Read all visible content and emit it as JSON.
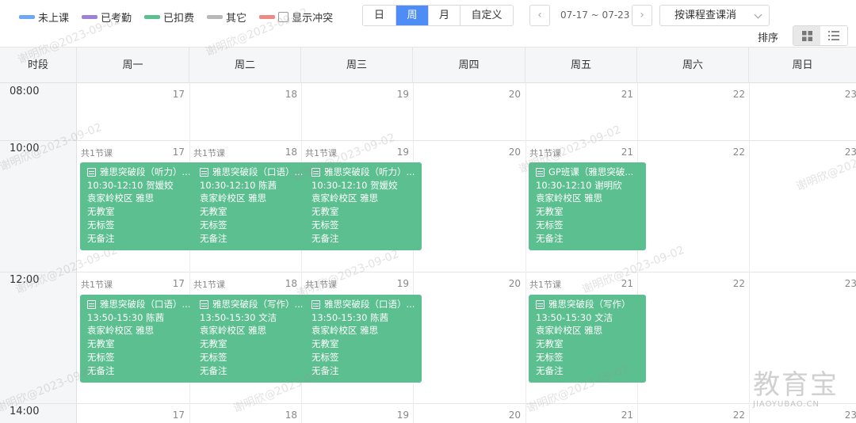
{
  "legend": [
    {
      "label": "未上课",
      "color": "#6ea7f2"
    },
    {
      "label": "已考勤",
      "color": "#9c82d6"
    },
    {
      "label": "已扣费",
      "color": "#5bbf8f"
    },
    {
      "label": "其它",
      "color": "#b8b8b8"
    },
    {
      "label": "显示冲突",
      "color": "#ee8a85"
    }
  ],
  "view_tabs": [
    "日",
    "周",
    "月",
    "自定义"
  ],
  "active_view": "周",
  "date_range": "07-17 ~ 07-23",
  "nav": {
    "prev": "‹",
    "next": "›"
  },
  "filter_select": "按课程查课消",
  "sort_label": "排序",
  "calendar": {
    "time_header": "时段",
    "days": [
      "周一",
      "周二",
      "周三",
      "周四",
      "周五",
      "周六",
      "周日"
    ],
    "dates": [
      "17",
      "18",
      "19",
      "20",
      "21",
      "22",
      "23"
    ],
    "slots": [
      "08:00",
      "10:00",
      "12:00",
      "14:00"
    ],
    "count_label": "共1节课"
  },
  "events": {
    "slot1": [
      {
        "day": 0,
        "title": "雅思突破段（听力）...",
        "time_teacher": "10:30-12:10  贺媛姣",
        "campus": "袁家岭校区    雅思",
        "room": "无教室",
        "tag": "无标签",
        "note": "无备注"
      },
      {
        "day": 1,
        "title": "雅思突破段（口语）...",
        "time_teacher": "10:30-12:10  陈茜",
        "campus": "袁家岭校区    雅思",
        "room": "无教室",
        "tag": "无标签",
        "note": "无备注"
      },
      {
        "day": 2,
        "title": "雅思突破段（听力）...",
        "time_teacher": "10:30-12:10  贺媛姣",
        "campus": "袁家岭校区    雅思",
        "room": "无教室",
        "tag": "无标签",
        "note": "无备注"
      },
      {
        "day": 4,
        "title": "GP班课（雅思突破...",
        "time_teacher": "10:30-12:10  谢明欣",
        "campus": "袁家岭校区    雅思",
        "room": "无教室",
        "tag": "无标签",
        "note": "无备注"
      }
    ],
    "slot2": [
      {
        "day": 0,
        "title": "雅思突破段（口语）...",
        "time_teacher": "13:50-15:30  陈茜",
        "campus": "袁家岭校区    雅思",
        "room": "无教室",
        "tag": "无标签",
        "note": "无备注"
      },
      {
        "day": 1,
        "title": "雅思突破段（写作）...",
        "time_teacher": "13:50-15:30  文洁",
        "campus": "袁家岭校区    雅思",
        "room": "无教室",
        "tag": "无标签",
        "note": "无备注"
      },
      {
        "day": 2,
        "title": "雅思突破段（口语）...",
        "time_teacher": "13:50-15:30  陈茜",
        "campus": "袁家岭校区    雅思",
        "room": "无教室",
        "tag": "无标签",
        "note": "无备注"
      },
      {
        "day": 4,
        "title": "雅思突破段（写作）",
        "time_teacher": "13:50-15:30  文洁",
        "campus": "袁家岭校区    雅思",
        "room": "无教室",
        "tag": "无标签",
        "note": "无备注"
      }
    ]
  },
  "watermark": "谢明欣@2023-09-02",
  "brand": {
    "cn": "教育宝",
    "en": "JIAOYUBAO.CN"
  }
}
